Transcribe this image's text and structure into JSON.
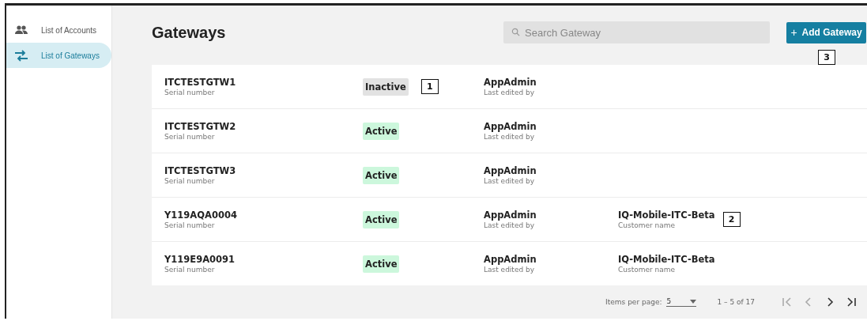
{
  "sidebar": {
    "items": [
      {
        "label": "List of Accounts",
        "kind": "people",
        "selected": false
      },
      {
        "label": "List of Gateways",
        "kind": "swap",
        "selected": true
      }
    ]
  },
  "header": {
    "title": "Gateways",
    "search": {
      "placeholder": "Search Gateway"
    },
    "add_button": {
      "icon": "+",
      "label": "Add Gateway",
      "callout": "3"
    }
  },
  "rows": [
    {
      "serial": "ITCTESTGTW1",
      "serial_label": "Serial number",
      "status": "Inactive",
      "active": false,
      "editor": "AppAdmin",
      "editor_label": "Last edited by",
      "callout": "1"
    },
    {
      "serial": "ITCTESTGTW2",
      "serial_label": "Serial number",
      "status": "Active",
      "active": true,
      "editor": "AppAdmin",
      "editor_label": "Last edited by"
    },
    {
      "serial": "ITCTESTGTW3",
      "serial_label": "Serial number",
      "status": "Active",
      "active": true,
      "editor": "AppAdmin",
      "editor_label": "Last edited by"
    },
    {
      "serial": "Y119AQA0004",
      "serial_label": "Serial number",
      "status": "Active",
      "active": true,
      "editor": "AppAdmin",
      "editor_label": "Last edited by",
      "customer": "IQ-Mobile-ITC-Beta",
      "customer_label": "Customer name",
      "customer_callout": "2"
    },
    {
      "serial": "Y119E9A0091",
      "serial_label": "Serial number",
      "status": "Active",
      "active": true,
      "editor": "AppAdmin",
      "editor_label": "Last edited by",
      "customer": "IQ-Mobile-ITC-Beta",
      "customer_label": "Customer name"
    }
  ],
  "paginator": {
    "items_label": "Items per page:",
    "page_size": "5",
    "range": "1 – 5 of 17",
    "buttons": [
      {
        "kind": "first",
        "disabled": true
      },
      {
        "kind": "prev",
        "disabled": true
      },
      {
        "kind": "next",
        "disabled": false
      },
      {
        "kind": "last",
        "disabled": false
      }
    ]
  }
}
